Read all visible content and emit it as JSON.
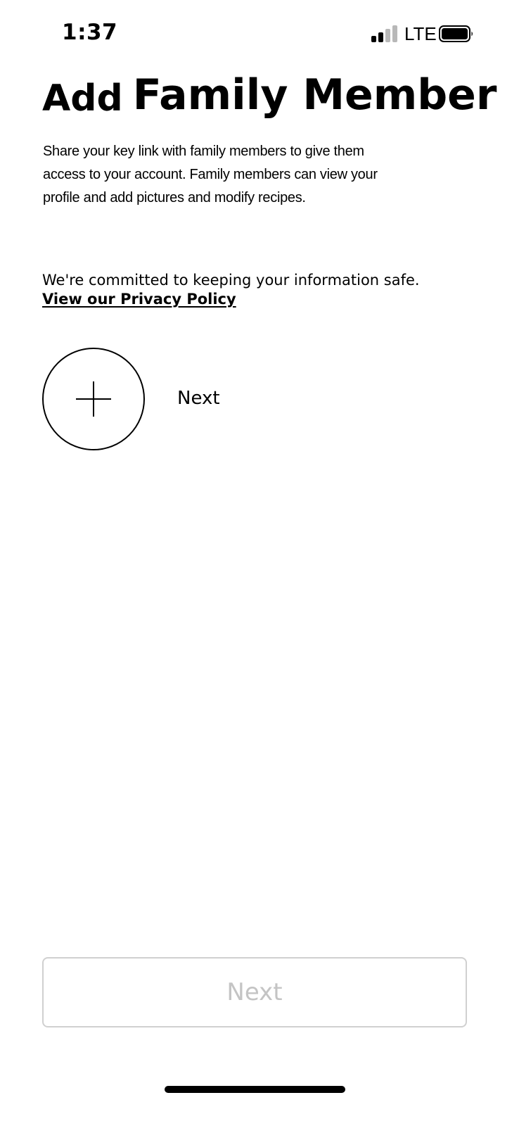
{
  "status_bar": {
    "time": "1:37",
    "network": "LTE",
    "signal_bars_active": 2,
    "signal_bars_total": 4,
    "battery_icon": "battery-full-icon",
    "signal_icon": "cellular-signal-icon"
  },
  "header": {
    "title_part1": "Add",
    "title_part2": "Family Member"
  },
  "description": "Share your key link with family members to give them access to your account. Family members can view your profile and add pictures and modify recipes.",
  "privacy": {
    "note": "We're committed to keeping your information safe.",
    "link_label": "View our Privacy Policy"
  },
  "add_member": {
    "icon": "plus-icon",
    "label": "Next"
  },
  "footer": {
    "next_button_label": "Next",
    "next_button_enabled": false
  },
  "colors": {
    "text": "#000000",
    "background": "#ffffff",
    "disabled_text": "#c4c4c4",
    "disabled_border": "#d0d0d0",
    "signal_inactive": "#b8b8b8"
  }
}
